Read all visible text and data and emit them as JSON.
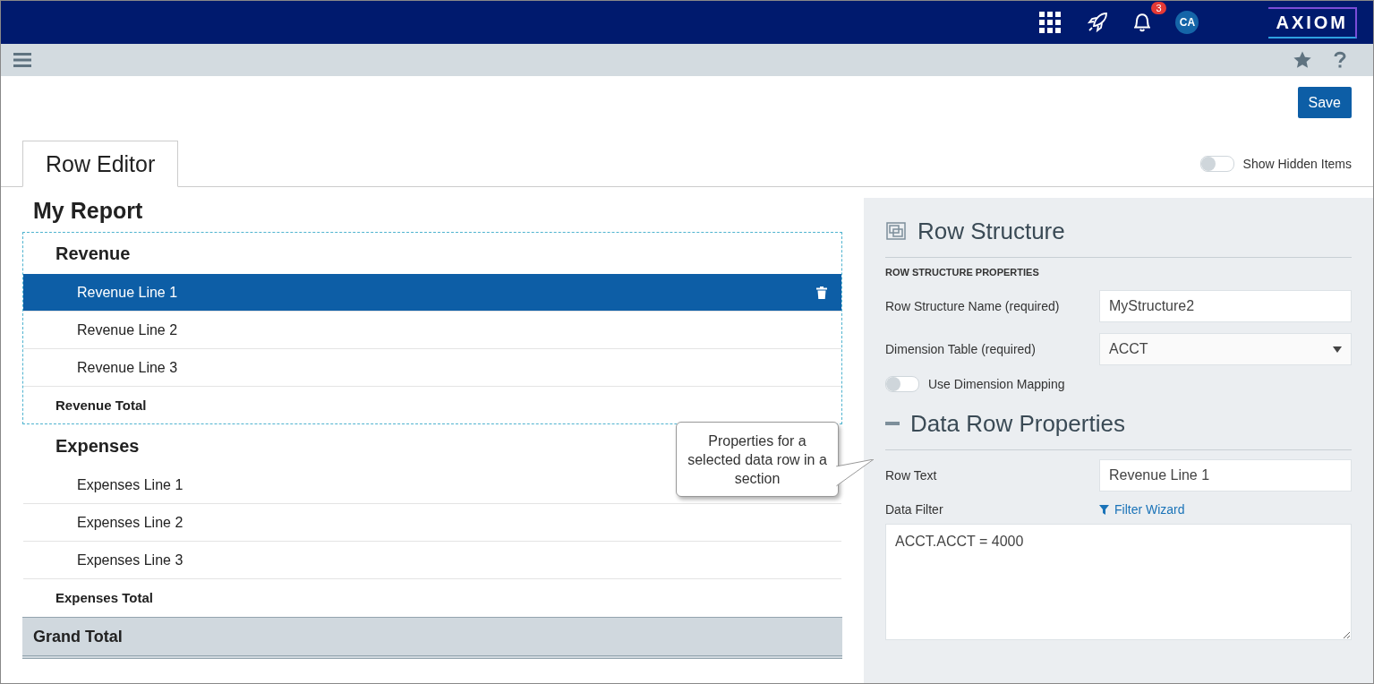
{
  "top_bar": {
    "notification_count": "3",
    "avatar": "CA",
    "logo": "AXIOM"
  },
  "save_button": "Save",
  "tabs": [
    {
      "label": "Row Editor",
      "selected": true
    }
  ],
  "show_hidden": {
    "label": "Show Hidden Items",
    "on": false
  },
  "report": {
    "title": "My Report",
    "sections": [
      {
        "title": "Revenue",
        "selected": true,
        "lines": [
          {
            "text": "Revenue Line 1",
            "selected": true
          },
          {
            "text": "Revenue Line 2",
            "selected": false
          },
          {
            "text": "Revenue Line 3",
            "selected": false
          }
        ],
        "total": "Revenue Total"
      },
      {
        "title": "Expenses",
        "selected": false,
        "lines": [
          {
            "text": "Expenses Line 1",
            "selected": false
          },
          {
            "text": "Expenses Line 2",
            "selected": false
          },
          {
            "text": "Expenses Line 3",
            "selected": false
          }
        ],
        "total": "Expenses Total"
      }
    ],
    "grand_total": "Grand Total"
  },
  "callout": "Properties for a selected data row in a section",
  "row_structure": {
    "title": "Row Structure",
    "subtitle": "ROW STRUCTURE PROPERTIES",
    "name_label": "Row Structure Name (required)",
    "name_value": "MyStructure2",
    "table_label": "Dimension Table (required)",
    "table_value": "ACCT",
    "mapping": {
      "label": "Use Dimension Mapping",
      "on": false
    }
  },
  "data_row": {
    "title": "Data Row Properties",
    "expanded": true,
    "row_text_label": "Row Text",
    "row_text_value": "Revenue Line 1",
    "filter_label": "Data Filter",
    "filter_link": "Filter Wizard",
    "filter_value": "ACCT.ACCT = 4000"
  }
}
